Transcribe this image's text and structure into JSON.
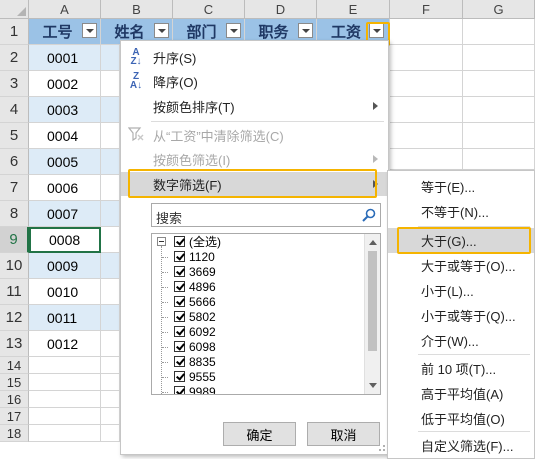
{
  "columns": [
    "A",
    "B",
    "C",
    "D",
    "E",
    "F",
    "G"
  ],
  "rows": [
    "1",
    "2",
    "3",
    "4",
    "5",
    "6",
    "7",
    "8",
    "9",
    "10",
    "11",
    "12",
    "13",
    "14",
    "15",
    "16",
    "17",
    "18"
  ],
  "selected_row": "9",
  "header_cells": [
    "工号",
    "姓名",
    "部门",
    "职务",
    "工资"
  ],
  "ids": [
    "0001",
    "0002",
    "0003",
    "0004",
    "0005",
    "0006",
    "0007",
    "0008",
    "0009",
    "0010",
    "0011",
    "0012"
  ],
  "filter_menu": {
    "sort_asc": "升序(S)",
    "sort_desc": "降序(O)",
    "sort_color": "按颜色排序(T)",
    "clear_filter": "从“工资”中清除筛选(C)",
    "filter_color": "按颜色筛选(I)",
    "number_filter": "数字筛选(F)",
    "search_placeholder": "搜索",
    "list_items": [
      "(全选)",
      "1120",
      "3669",
      "4896",
      "5666",
      "5802",
      "6092",
      "6098",
      "8835",
      "9555",
      "9989"
    ],
    "ok": "确定",
    "cancel": "取消"
  },
  "number_filter_submenu": [
    "等于(E)...",
    "不等于(N)...",
    "大于(G)...",
    "大于或等于(O)...",
    "小于(L)...",
    "小于或等于(Q)...",
    "介于(W)...",
    "前 10 项(T)...",
    "高于平均值(A)",
    "低于平均值(O)",
    "自定义筛选(F)..."
  ],
  "highlight_color": "#f5b400",
  "header_fill": "#9bc2e6",
  "band_fill": "#ddebf7"
}
